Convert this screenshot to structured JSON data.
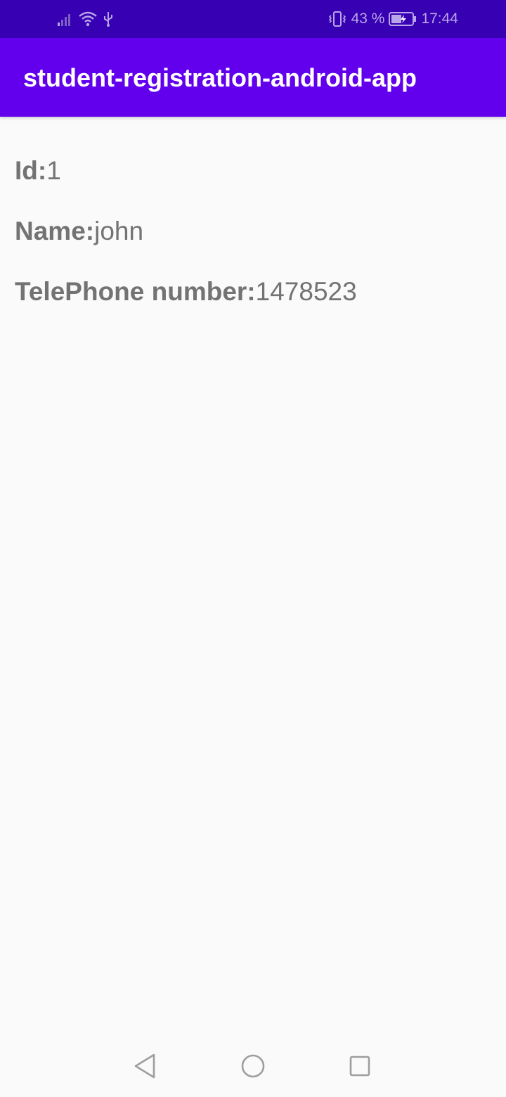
{
  "status_bar": {
    "battery_percent": "43 %",
    "time": "17:44",
    "icons": [
      "signal-icon",
      "wifi-icon",
      "usb-icon",
      "vibrate-icon",
      "battery-icon"
    ]
  },
  "app_bar": {
    "title": "student-registration-android-app"
  },
  "student": {
    "fields": [
      {
        "label": "Id:",
        "value": "1"
      },
      {
        "label": "Name:",
        "value": "john"
      },
      {
        "label": "TelePhone number:",
        "value": "1478523"
      }
    ]
  },
  "nav_bar": {
    "icons": [
      "back-icon",
      "home-icon",
      "recents-icon"
    ]
  },
  "colors": {
    "status_bar": "#3700b3",
    "app_bar": "#6200ee",
    "background": "#fafafa",
    "text": "#737373"
  }
}
